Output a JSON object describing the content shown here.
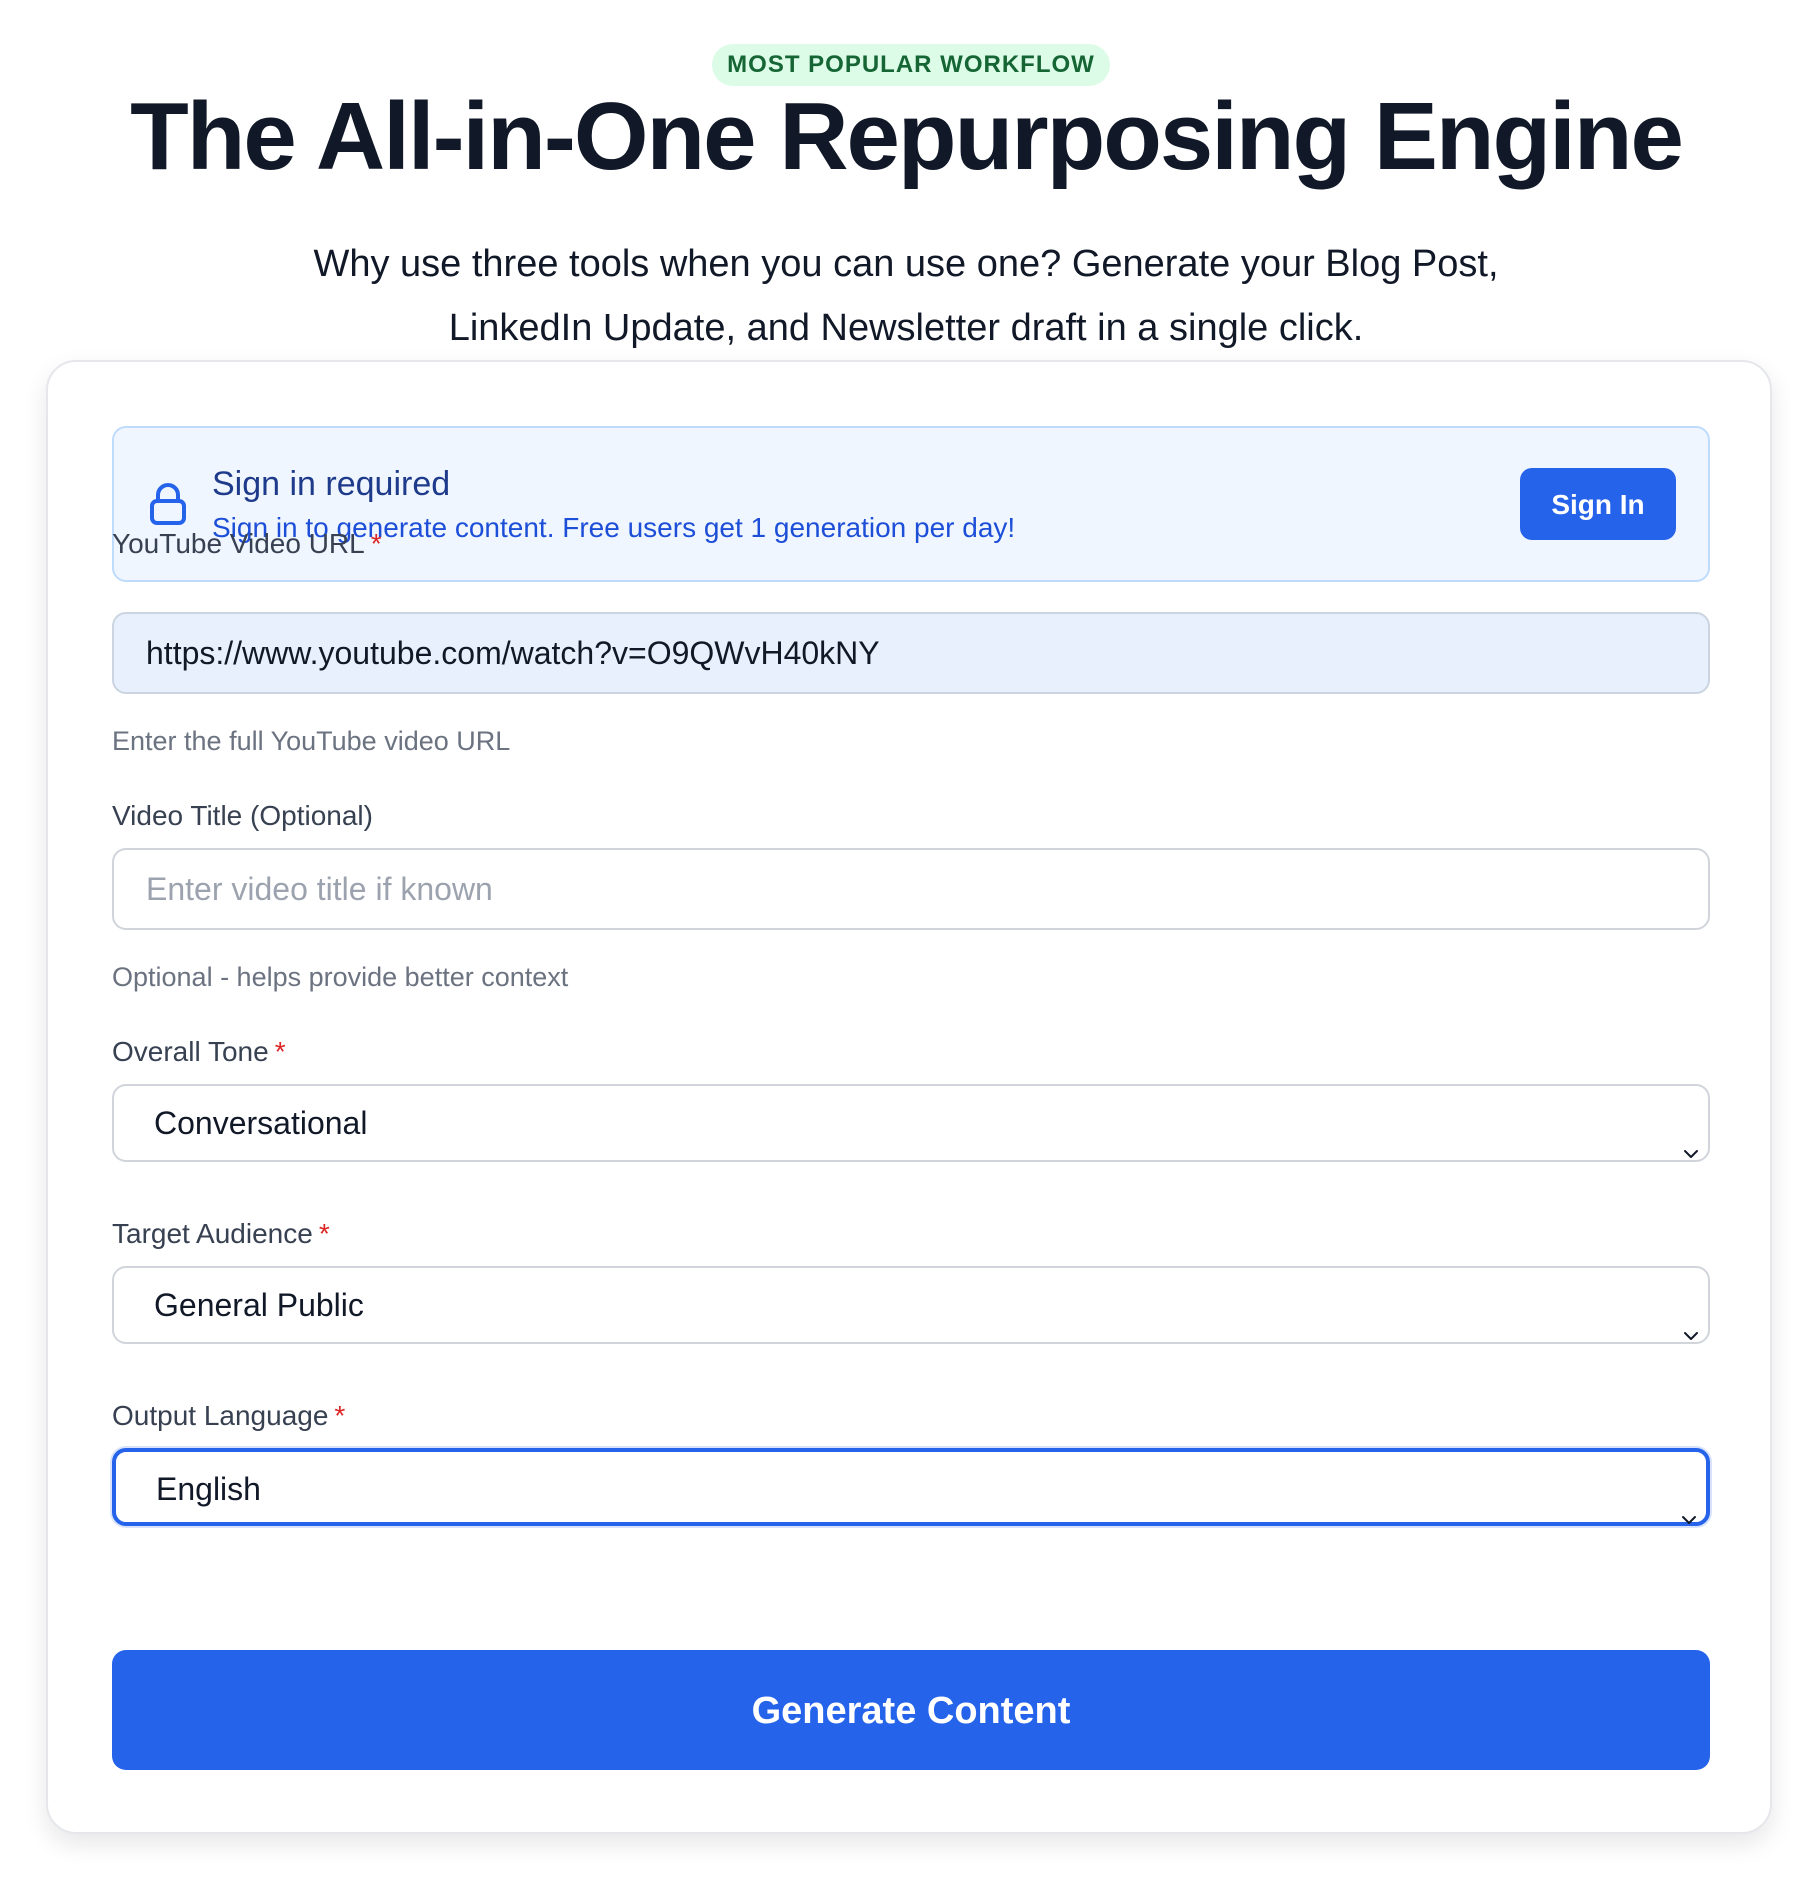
{
  "hero": {
    "badge": "MOST POPULAR WORKFLOW",
    "title": "The All-in-One Repurposing Engine",
    "subtitle_line_1": "Why use three tools when you can use one? Generate your Blog Post,",
    "subtitle_line_2": "LinkedIn Update, and Newsletter draft in a single click."
  },
  "notice": {
    "icon": "lock-icon",
    "title": "Sign in required",
    "text": "Sign in to generate content. Free users get 1 generation per day!",
    "button_label": "Sign In"
  },
  "form": {
    "required_marker": "*",
    "youtube_url": {
      "label": "YouTube Video URL",
      "value": "https://www.youtube.com/watch?v=O9QWvH40kNY",
      "helper": "Enter the full YouTube video URL"
    },
    "video_title": {
      "label": "Video Title (Optional)",
      "placeholder": "Enter video title if known",
      "helper": "Optional - helps provide better context"
    },
    "overall_tone": {
      "label": "Overall Tone",
      "selected": "Conversational"
    },
    "target_audience": {
      "label": "Target Audience",
      "selected": "General Public"
    },
    "output_language": {
      "label": "Output Language",
      "selected": "English"
    },
    "generate_button": "Generate Content"
  },
  "colors": {
    "accent": "#2563eb",
    "badge_bg": "#dcfce7",
    "badge_text": "#166534",
    "notice_bg": "#eff6ff",
    "required": "#dc2626"
  }
}
